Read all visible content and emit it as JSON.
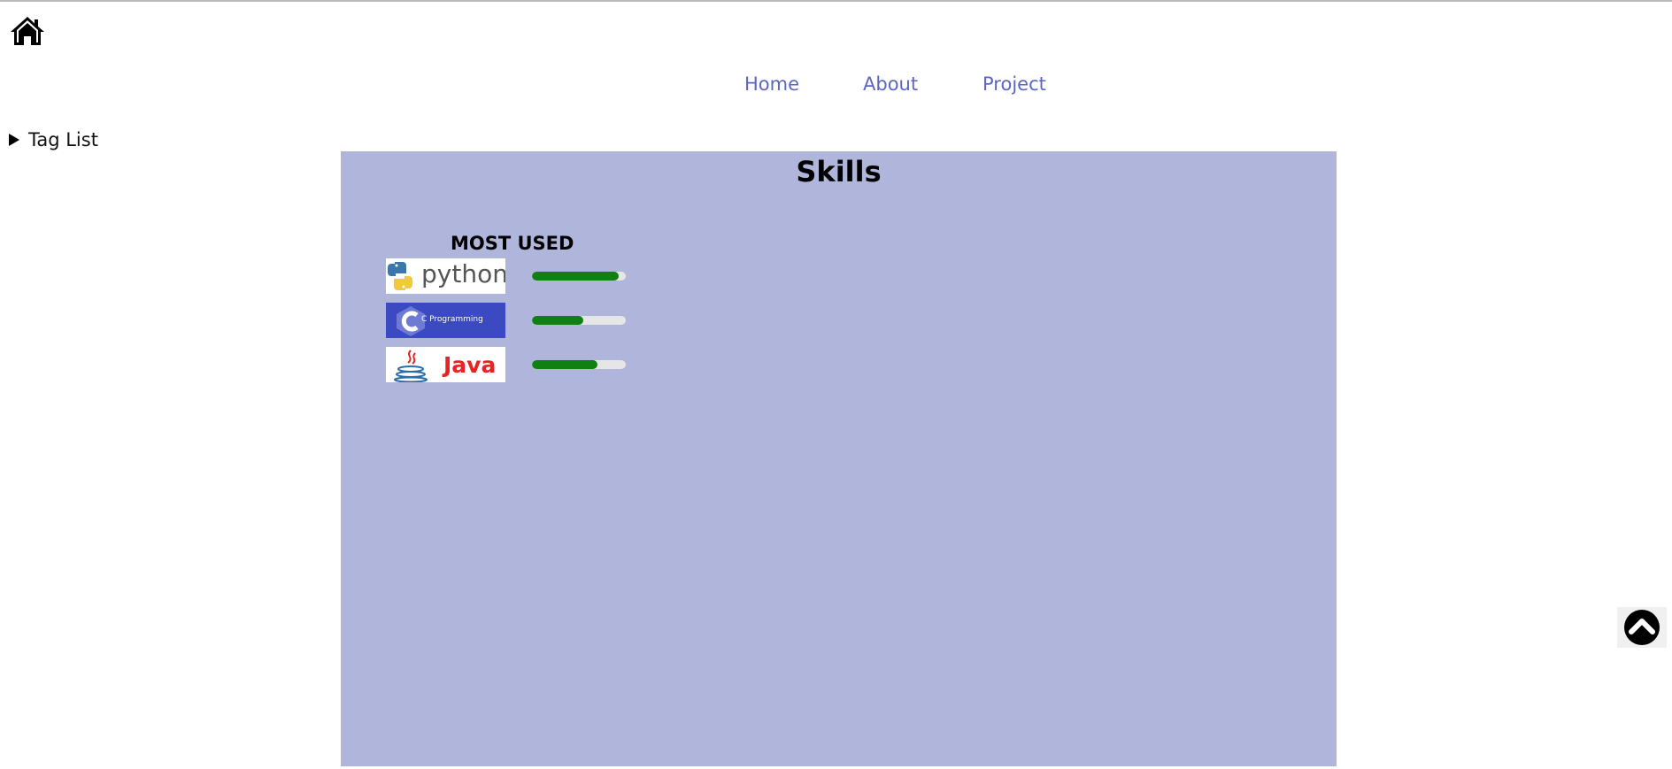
{
  "nav": {
    "home_label": "Home",
    "about_label": "About",
    "project_label": "Project"
  },
  "taglist": {
    "label": "Tag List"
  },
  "skills": {
    "title": "Skills",
    "section_label": "MOST USED",
    "items": [
      {
        "name": "python",
        "logo_icon": "python-logo",
        "level": 0.92
      },
      {
        "name": "C Programming",
        "logo_icon": "c-programming-logo",
        "level": 0.55
      },
      {
        "name": "Java",
        "logo_icon": "java-logo",
        "level": 0.7
      }
    ]
  },
  "icons": {
    "home": "home-icon",
    "scroll_top": "chevron-up-circle-icon",
    "taglist_toggle": "triangle-right-icon"
  },
  "colors": {
    "panel_bg": "#b0b5db",
    "nav_link": "#5b66c4",
    "bar_fill": "#118013",
    "bar_track": "#e6e6e6"
  }
}
